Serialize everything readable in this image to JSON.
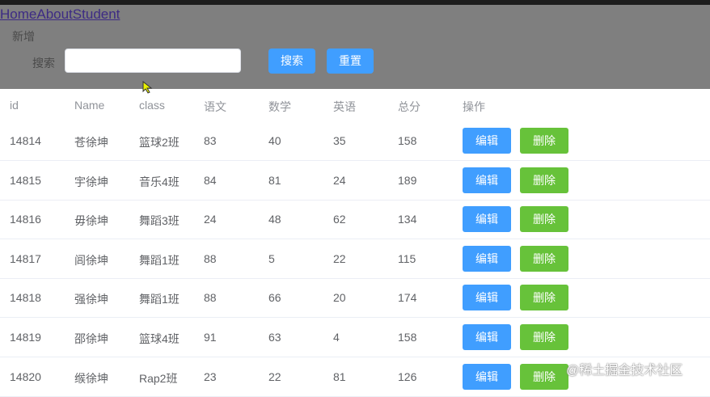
{
  "nav": {
    "links": [
      "Home",
      "About",
      "Student"
    ]
  },
  "toolbar": {
    "add_label": "新增",
    "search_label": "搜索",
    "search_value": "",
    "search_button": "搜索",
    "reset_button": "重置"
  },
  "table": {
    "headers": [
      "id",
      "Name",
      "class",
      "语文",
      "数学",
      "英语",
      "总分",
      "操作"
    ],
    "rows": [
      {
        "id": "14814",
        "name": "苍徐坤",
        "class": "篮球2班",
        "chinese": "83",
        "math": "40",
        "english": "35",
        "total": "158"
      },
      {
        "id": "14815",
        "name": "宇徐坤",
        "class": "音乐4班",
        "chinese": "84",
        "math": "81",
        "english": "24",
        "total": "189"
      },
      {
        "id": "14816",
        "name": "毋徐坤",
        "class": "舞蹈3班",
        "chinese": "24",
        "math": "48",
        "english": "62",
        "total": "134"
      },
      {
        "id": "14817",
        "name": "闾徐坤",
        "class": "舞蹈1班",
        "chinese": "88",
        "math": "5",
        "english": "22",
        "total": "115"
      },
      {
        "id": "14818",
        "name": "强徐坤",
        "class": "舞蹈1班",
        "chinese": "88",
        "math": "66",
        "english": "20",
        "total": "174"
      },
      {
        "id": "14819",
        "name": "邵徐坤",
        "class": "篮球4班",
        "chinese": "91",
        "math": "63",
        "english": "4",
        "total": "158"
      },
      {
        "id": "14820",
        "name": "缑徐坤",
        "class": "Rap2班",
        "chinese": "23",
        "math": "22",
        "english": "81",
        "total": "126"
      }
    ],
    "edit_label": "编辑",
    "delete_label": "删除"
  },
  "watermark": "@稀土掘金技术社区",
  "colors": {
    "primary": "#409eff",
    "success": "#67c23a",
    "overlay": "rgba(0,0,0,0.5)"
  },
  "icons": {
    "cursor": "mouse-pointer-icon"
  }
}
